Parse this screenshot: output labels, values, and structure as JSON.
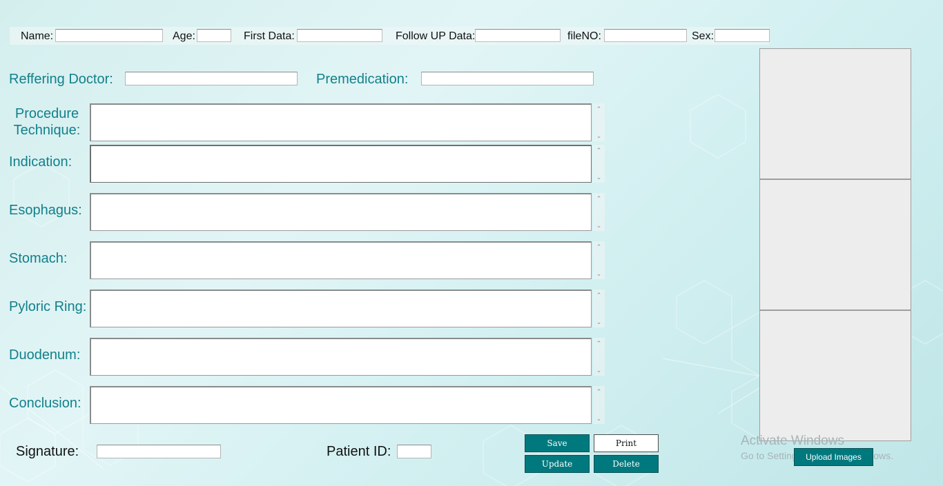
{
  "header_fields": {
    "name": {
      "label": "Name:",
      "value": ""
    },
    "age": {
      "label": "Age:",
      "value": ""
    },
    "first_data": {
      "label": "First Data:",
      "value": ""
    },
    "follow_up_data": {
      "label": "Follow UP Data:",
      "value": ""
    },
    "file_no": {
      "label": "fileNO:",
      "value": ""
    },
    "sex": {
      "label": "Sex:",
      "value": ""
    }
  },
  "referring_doctor": {
    "label": "Reffering Doctor:",
    "value": ""
  },
  "premedication": {
    "label": "Premedication:",
    "value": ""
  },
  "sections": [
    {
      "label_line1": "Procedure",
      "label_line2": "Technique:",
      "value": ""
    },
    {
      "label": "Indication:",
      "value": ""
    },
    {
      "label": "Esophagus:",
      "value": ""
    },
    {
      "label": "Stomach:",
      "value": ""
    },
    {
      "label": "Pyloric Ring:",
      "value": ""
    },
    {
      "label": "Duodenum:",
      "value": ""
    },
    {
      "label": "Conclusion:",
      "value": ""
    }
  ],
  "signature": {
    "label": "Signature:",
    "value": ""
  },
  "patient_id": {
    "label": "Patient ID:",
    "value": ""
  },
  "buttons": {
    "save": "Save",
    "print": "Print",
    "update": "Update",
    "delete": "Delete",
    "upload_images": "Upload Images"
  },
  "watermark": {
    "title": "Activate Windows",
    "subtitle": "Go to Settings to activate Windows."
  },
  "colors": {
    "label_teal": "#12808a",
    "button_teal": "#00797e",
    "background": "#d9f1f2"
  }
}
